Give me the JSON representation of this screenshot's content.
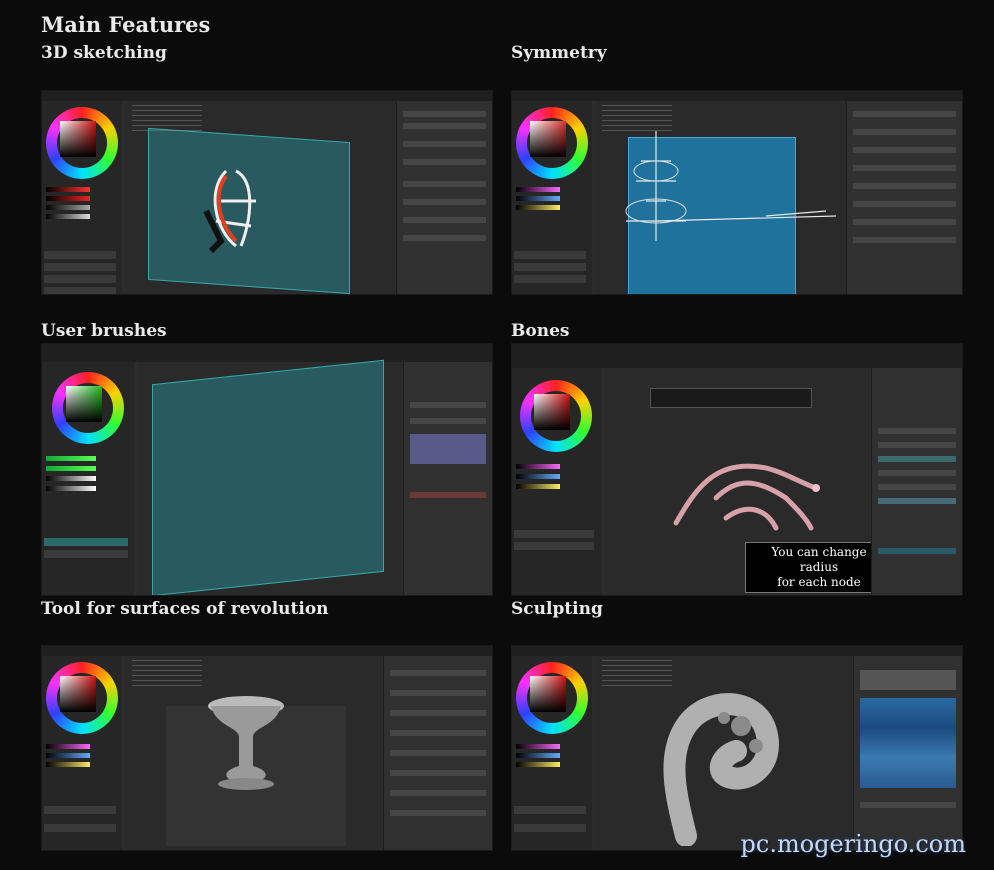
{
  "title": "Main Features",
  "features": [
    {
      "caption": "3D sketching"
    },
    {
      "caption": "Symmetry"
    },
    {
      "caption": "User brushes"
    },
    {
      "caption": "Bones"
    },
    {
      "caption": "Tool for surfaces of revolution"
    },
    {
      "caption": "Sculpting"
    }
  ],
  "bones_caption": "You can change radius\nfor each node",
  "watermark": "pc.mogeringo.com",
  "colors": {
    "background": "#0b0b0b",
    "plane": "#2a8a8c",
    "symmetry_plane": "#1d7fb0",
    "text": "#eaeaea"
  }
}
